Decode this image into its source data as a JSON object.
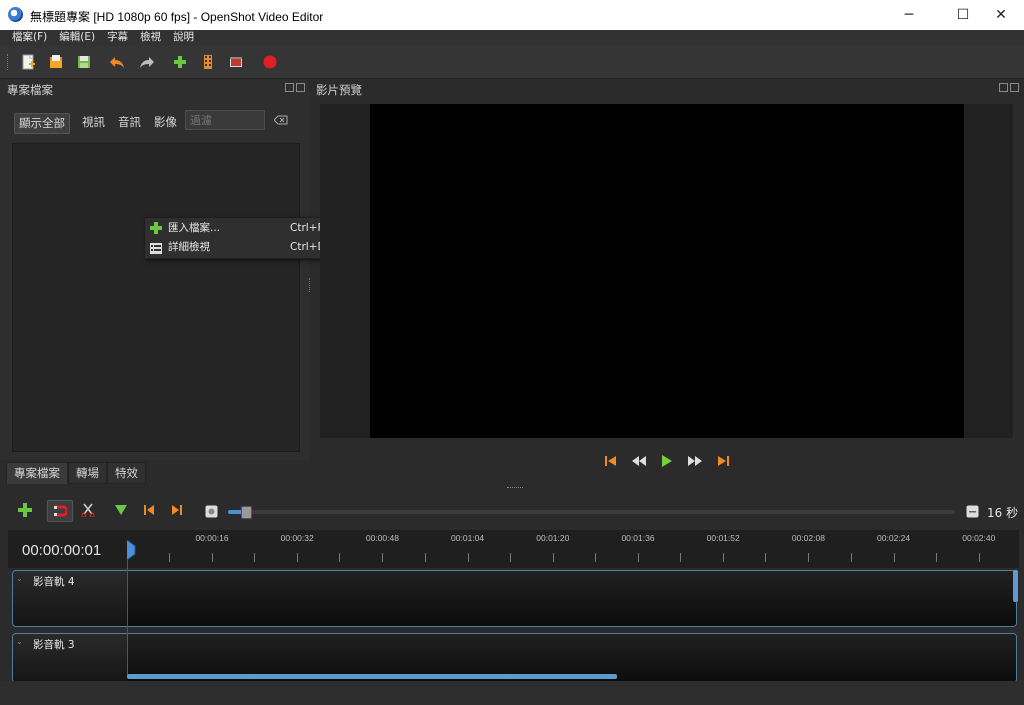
{
  "window": {
    "title": "無標題專案 [HD 1080p 60 fps] - OpenShot Video Editor",
    "minimize": "─",
    "maximize": "☐",
    "close": "✕"
  },
  "menu": [
    "檔案(F)",
    "編輯(E)",
    "字幕",
    "檢視",
    "說明"
  ],
  "toolbar_icons": [
    "new-project-icon",
    "open-project-icon",
    "save-project-icon",
    "undo-icon",
    "redo-icon",
    "import-files-icon",
    "profile-icon",
    "fullscreen-icon",
    "export-video-icon"
  ],
  "project_files": {
    "title": "專案檔案",
    "filters": {
      "all": "顯示全部",
      "video": "視訊",
      "audio": "音訊",
      "image": "影像"
    },
    "search_placeholder": "過濾"
  },
  "context_menu": {
    "import": {
      "label": "匯入檔案...",
      "shortcut": "Ctrl+F"
    },
    "details": {
      "label": "詳細檢視",
      "shortcut": "Ctrl+D"
    }
  },
  "left_tabs": [
    "專案檔案",
    "轉場",
    "特效"
  ],
  "preview": {
    "title": "影片預覽"
  },
  "timeline": {
    "zoom_label": "16 秒",
    "timecode": "00:00:00:01",
    "ticks": [
      "00:00:16",
      "00:00:32",
      "00:00:48",
      "00:01:04",
      "00:01:20",
      "00:01:36",
      "00:01:52",
      "00:02:08",
      "00:02:24",
      "00:02:40"
    ],
    "tracks": [
      "影音軌 4",
      "影音軌 3"
    ]
  },
  "colors": {
    "accent": "#4a90d9",
    "playhead": "#d02020",
    "record": "#e02020",
    "add_green": "#6cc644"
  }
}
